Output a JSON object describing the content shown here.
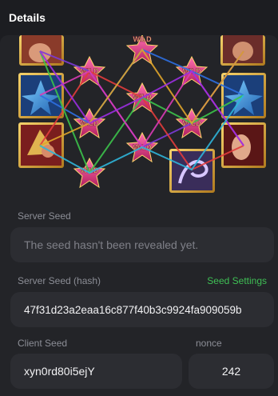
{
  "header": {
    "title": "Details"
  },
  "game": {
    "win_symbol_text": "WILD",
    "line_colors": [
      "#7b3bd6",
      "#2e6fe0",
      "#e23c3c",
      "#3cc24a",
      "#d93bb5",
      "#e0a52a",
      "#9b2fe0",
      "#2fb5d9"
    ]
  },
  "server_seed": {
    "label": "Server Seed",
    "placeholder": "The seed hasn't been revealed yet."
  },
  "server_seed_hash": {
    "label": "Server Seed (hash)",
    "settings_link": "Seed Settings",
    "value": "47f31d23a2eaa16c877f40b3c9924fa909059b"
  },
  "client_seed": {
    "label": "Client Seed",
    "value": "xyn0rd80i5ejY"
  },
  "nonce": {
    "label": "nonce",
    "value": "242"
  },
  "colors": {
    "accent_green": "#3fbf55",
    "background": "#1c1d21",
    "panel": "#232428",
    "field": "#2c2d32"
  }
}
